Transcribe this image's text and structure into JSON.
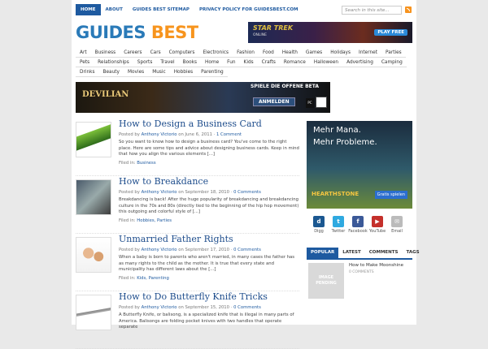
{
  "nav": {
    "items": [
      "HOME",
      "ABOUT",
      "GUIDES BEST SITEMAP",
      "PRIVACY POLICY FOR GUIDESBEST.COM"
    ]
  },
  "search": {
    "placeholder": "Search in this site..."
  },
  "logo": {
    "part1": "GUIDES",
    "part2": "BEST"
  },
  "top_ad": {
    "title": "STAR TREK",
    "sub": "ONLINE",
    "button": "PLAY FREE"
  },
  "categories": [
    "Art",
    "Business",
    "Careers",
    "Cars",
    "Computers",
    "Electronics",
    "Fashion",
    "Food",
    "Health",
    "Games",
    "Holidays",
    "Internet",
    "Parties",
    "Pets",
    "Relationships",
    "Sports",
    "Travel",
    "Books",
    "Home",
    "Fun",
    "Kids",
    "Crafts",
    "Romance",
    "Halloween",
    "Advertising",
    "Camping",
    "Drinks",
    "Beauty",
    "Movies",
    "Music",
    "Hobbies",
    "Parenting"
  ],
  "banner_ad": {
    "title": "DEVILIAN",
    "headline": "SPIELE DIE OFFENE BETA",
    "button": "ANMELDEN",
    "pc": "PC"
  },
  "posts": [
    {
      "title": "How to Design a Business Card",
      "posted_by": "Posted by",
      "author": "Anthony Victorio",
      "on": "on",
      "date": "June 6, 2011",
      "comments": "1 Comment",
      "body": "So you want to know how to design a business card? You've come to the right place. Here are some tips and advice about designing business cards. Keep in mind that how you align the various elements [...]",
      "filed_label": "Filed in:",
      "filed": "Business"
    },
    {
      "title": "How to Breakdance",
      "posted_by": "Posted by",
      "author": "Anthony Victorio",
      "on": "on",
      "date": "September 18, 2010",
      "comments": "0 Comments",
      "body": "Breakdancing is back! After the huge popularity of breakdancing and breakdancing culture in the 70s and 80s (directly tied to the beginning of the hip hop movement) this outgoing and colorful style of [...]",
      "filed_label": "Filed in:",
      "filed": "Hobbies, Parties"
    },
    {
      "title": "Unmarried Father Rights",
      "posted_by": "Posted by",
      "author": "Anthony Victorio",
      "on": "on",
      "date": "September 17, 2010",
      "comments": "0 Comments",
      "body": "When a baby is born to parents who aren't married, in many cases the father has as many rights to the child as the mother. It is true that every state and municipality has different laws about the [...]",
      "filed_label": "Filed in:",
      "filed": "Kids, Parenting"
    },
    {
      "title": "How to Do Butterfly Knife Tricks",
      "posted_by": "Posted by",
      "author": "Anthony Victorio",
      "on": "on",
      "date": "September 15, 2010",
      "comments": "0 Comments",
      "body": "A Butterfly Knife, or balisong, is a specialized knife that is illegal in many parts of America. Balisongs are folding pocket knives with two handles that operate separate",
      "filed_label": "",
      "filed": ""
    }
  ],
  "side_ad": {
    "line1": "Mehr Mana.",
    "line2": "Mehr Probleme.",
    "logo": "HEARTHSTONE",
    "button": "Gratis spielen"
  },
  "social": [
    {
      "label": "Digg",
      "icon": "digg-icon",
      "color": "#1b5891",
      "glyph": "d"
    },
    {
      "label": "Twitter",
      "icon": "twitter-icon",
      "color": "#2fa9e0",
      "glyph": "t"
    },
    {
      "label": "Facebook",
      "icon": "facebook-icon",
      "color": "#3b5998",
      "glyph": "f"
    },
    {
      "label": "YouTube",
      "icon": "youtube-icon",
      "color": "#c4302b",
      "glyph": "▶"
    },
    {
      "label": "Email",
      "icon": "email-icon",
      "color": "#bbbbbb",
      "glyph": "✉"
    }
  ],
  "tabs": [
    "POPULAR",
    "LATEST",
    "COMMENTS",
    "TAGS"
  ],
  "popular": {
    "thumb_text": "IMAGE PENDING",
    "title": "How to Make Moonshine",
    "comments": "0 COMMENTS"
  },
  "colors": {
    "brand_blue": "#1e5aa0",
    "brand_orange": "#f7941d"
  }
}
